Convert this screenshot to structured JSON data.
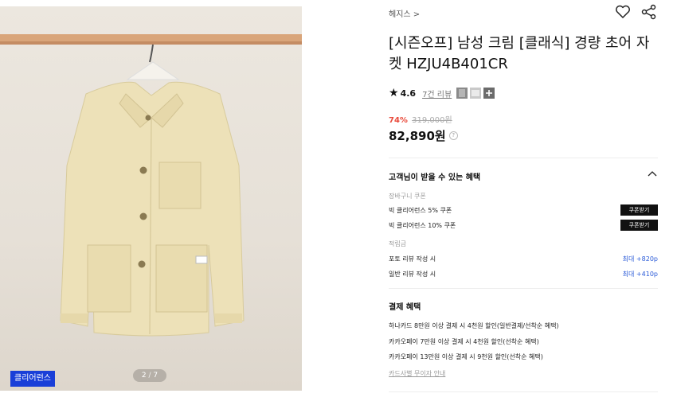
{
  "image": {
    "badge": "클리어런스",
    "pager_current": "2",
    "pager_sep": "/",
    "pager_total": "7"
  },
  "product": {
    "brand": "헤지스 >",
    "title": "[시즌오프] 남성 크림 [클래식] 경량 초어 자켓 HZJU4B401CR",
    "rating": "4.6",
    "review_link": "7건 리뷰",
    "discount": "74%",
    "original_price": "319,000원",
    "price": "82,890원",
    "help_mark": "?"
  },
  "benefits": {
    "title": "고객님이 받을 수 있는 혜택",
    "coupon_section": "장바구니 쿠폰",
    "coupons": [
      {
        "label": "빅 클리어런스 5% 쿠폰",
        "button": "쿠폰받기"
      },
      {
        "label": "빅 클리어런스 10% 쿠폰",
        "button": "쿠폰받기"
      }
    ],
    "points_section": "적립금",
    "points": [
      {
        "label": "포토 리뷰 작성 시",
        "value": "최대 +820p"
      },
      {
        "label": "일반 리뷰 작성 시",
        "value": "최대 +410p"
      }
    ]
  },
  "payment": {
    "title": "결제 혜택",
    "items": [
      "하나카드 8만원 이상 결제 시 4천원 할인(일반결제/선착순 혜택)",
      "카카오페이 7만원 이상 결제 시 4천원 할인(선착순 혜택)",
      "카카오페이 13만원 이상 결제 시 9천원 할인(선착순 혜택)"
    ],
    "card_link": "카드사별 무이자 안내"
  },
  "colors": {
    "accent_blue": "#1a3fd8",
    "discount_red": "#e94b3c",
    "point_blue": "#2b5bd8"
  },
  "icons": [
    "heart-icon",
    "share-icon",
    "star-icon",
    "chevron-up-icon",
    "help-icon"
  ]
}
